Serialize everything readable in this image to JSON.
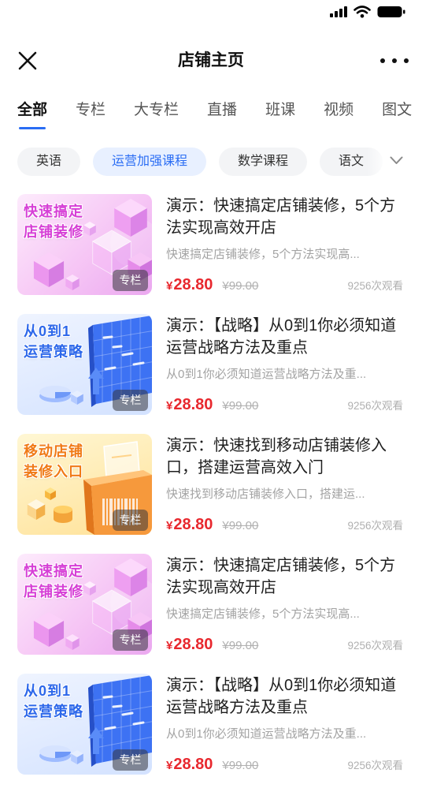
{
  "status_bar": {
    "signal_icon": "signal-icon",
    "wifi_icon": "wifi-icon",
    "battery_icon": "battery-icon"
  },
  "header": {
    "title": "店铺主页",
    "close_icon": "close-icon",
    "more_icon": "more-dots-icon"
  },
  "tabs": [
    {
      "label": "全部",
      "active": true
    },
    {
      "label": "专栏",
      "active": false
    },
    {
      "label": "大专栏",
      "active": false
    },
    {
      "label": "直播",
      "active": false
    },
    {
      "label": "班课",
      "active": false
    },
    {
      "label": "视频",
      "active": false
    },
    {
      "label": "图文",
      "active": false
    }
  ],
  "chips": [
    {
      "label": "英语",
      "active": false
    },
    {
      "label": "运营加强课程",
      "active": true
    },
    {
      "label": "数学课程",
      "active": false
    },
    {
      "label": "语文",
      "active": false
    }
  ],
  "chips_expand_icon": "chevron-down-icon",
  "colors": {
    "accent": "#2a6df4",
    "price": "#e8282e",
    "chip_active_bg": "#e8f0ff",
    "text_primary": "#1f1f1f",
    "text_secondary": "#a3a3a3",
    "caption_pink": "#d63fd6",
    "caption_blue": "#2c67ea",
    "caption_orange": "#f07a16"
  },
  "items": [
    {
      "thumb": {
        "theme": "pink",
        "line1": "快速搞定",
        "line2": "店铺装修",
        "badge": "专栏"
      },
      "title": "演示：快速搞定店铺装修，5个方法实现高效开店",
      "desc": "快速搞定店铺装修，5个方法实现高...",
      "price_symbol": "¥",
      "price": "28.80",
      "original_price": "¥99.00",
      "views": "9256次观看"
    },
    {
      "thumb": {
        "theme": "blue",
        "line1": "从0到1",
        "line2": "运营策略",
        "badge": "专栏"
      },
      "title": "演示：【战略】从0到1你必须知道运营战略方法及重点",
      "desc": "从0到1你必须知道运营战略方法及重...",
      "price_symbol": "¥",
      "price": "28.80",
      "original_price": "¥99.00",
      "views": "9256次观看"
    },
    {
      "thumb": {
        "theme": "orange",
        "line1": "移动店铺",
        "line2": "装修入口",
        "badge": "专栏"
      },
      "title": "演示：快速找到移动店铺装修入口，搭建运营高效入门",
      "desc": "快速找到移动店铺装修入口，搭建运...",
      "price_symbol": "¥",
      "price": "28.80",
      "original_price": "¥99.00",
      "views": "9256次观看"
    },
    {
      "thumb": {
        "theme": "pink",
        "line1": "快速搞定",
        "line2": "店铺装修",
        "badge": "专栏"
      },
      "title": "演示：快速搞定店铺装修，5个方法实现高效开店",
      "desc": "快速搞定店铺装修，5个方法实现高...",
      "price_symbol": "¥",
      "price": "28.80",
      "original_price": "¥99.00",
      "views": "9256次观看"
    },
    {
      "thumb": {
        "theme": "blue",
        "line1": "从0到1",
        "line2": "运营策略",
        "badge": "专栏"
      },
      "title": "演示：【战略】从0到1你必须知道运营战略方法及重点",
      "desc": "从0到1你必须知道运营战略方法及重...",
      "price_symbol": "¥",
      "price": "28.80",
      "original_price": "¥99.00",
      "views": "9256次观看"
    }
  ]
}
